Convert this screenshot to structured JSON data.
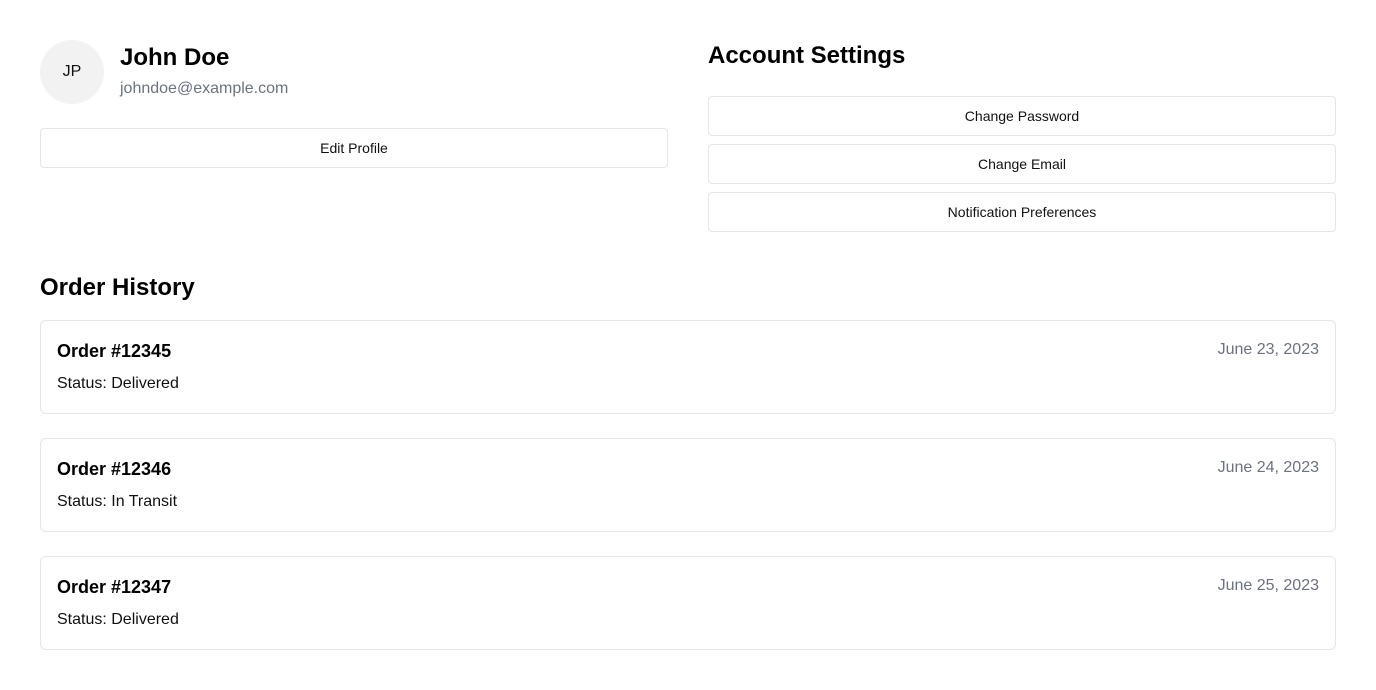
{
  "profile": {
    "initials": "JP",
    "name": "John Doe",
    "email": "johndoe@example.com",
    "edit_label": "Edit Profile"
  },
  "settings": {
    "title": "Account Settings",
    "change_password_label": "Change Password",
    "change_email_label": "Change Email",
    "notifications_label": "Notification Preferences"
  },
  "orders": {
    "title": "Order History",
    "items": [
      {
        "id": "Order #12345",
        "status": "Status: Delivered",
        "date": "June 23, 2023"
      },
      {
        "id": "Order #12346",
        "status": "Status: In Transit",
        "date": "June 24, 2023"
      },
      {
        "id": "Order #12347",
        "status": "Status: Delivered",
        "date": "June 25, 2023"
      }
    ]
  },
  "colors": {
    "muted_text": "#6b7280",
    "border": "#e5e7eb",
    "avatar_bg": "#f2f2f2"
  }
}
